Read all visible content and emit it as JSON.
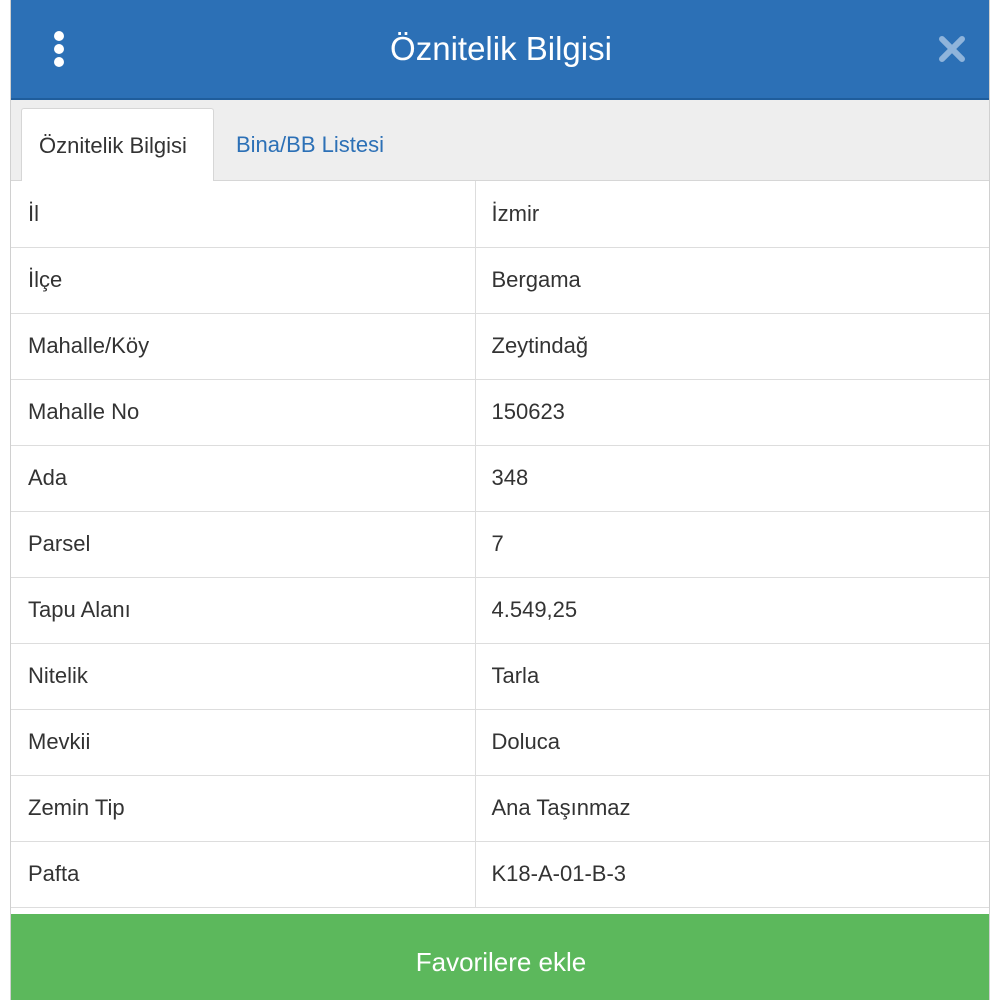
{
  "header": {
    "title": "Öznitelik Bilgisi",
    "menu_icon": "vertical-ellipsis-icon",
    "close_icon": "close-icon"
  },
  "tabs": [
    {
      "label": "Öznitelik Bilgisi",
      "active": true
    },
    {
      "label": "Bina/BB Listesi",
      "active": false
    }
  ],
  "attributes": [
    {
      "key": "İl",
      "value": "İzmir"
    },
    {
      "key": "İlçe",
      "value": "Bergama"
    },
    {
      "key": "Mahalle/Köy",
      "value": "Zeytindağ"
    },
    {
      "key": "Mahalle No",
      "value": "150623"
    },
    {
      "key": "Ada",
      "value": "348"
    },
    {
      "key": "Parsel",
      "value": "7"
    },
    {
      "key": "Tapu Alanı",
      "value": "4.549,25"
    },
    {
      "key": "Nitelik",
      "value": "Tarla"
    },
    {
      "key": "Mevkii",
      "value": "Doluca"
    },
    {
      "key": "Zemin Tip",
      "value": "Ana Taşınmaz"
    },
    {
      "key": "Pafta",
      "value": "K18-A-01-B-3"
    }
  ],
  "footer": {
    "button_label": "Favorilere ekle"
  },
  "colors": {
    "header": "#2c70b6",
    "tab_link": "#2c70b6",
    "favorite_button": "#5cb85c"
  }
}
